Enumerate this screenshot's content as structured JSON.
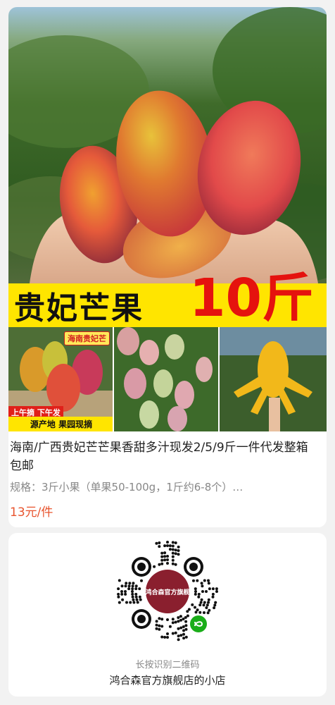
{
  "product": {
    "banner_name": "贵妃芒果",
    "banner_weight": "10斤",
    "thumb1_tag_top": "海南贵妃芒",
    "thumb1_tag_red": "上午摘 下午发",
    "thumb1_tag_yellow": "源产地 果园现摘",
    "title": "海南/广西贵妃芒芒果香甜多汁现发2/5/9斤一件代发整箱包邮",
    "spec": "规格：3斤小果（单果50-100g，1斤约6-8个）…",
    "price": "13元/件"
  },
  "qr": {
    "center_logo_text": "鸿合森官方旗舰",
    "hint": "长按识别二维码",
    "shop_name": "鸿合森官方旗舰店的小店"
  },
  "colors": {
    "price": "#e8542e",
    "banner_bg": "#ffe500",
    "banner_weight": "#e5120e",
    "miniprogram_green": "#1aad19"
  }
}
